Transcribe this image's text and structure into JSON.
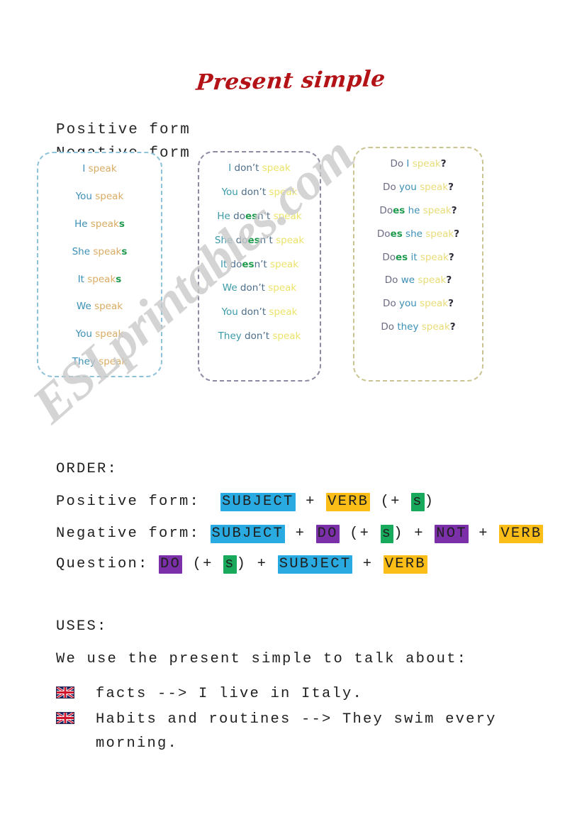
{
  "title": "Present simple",
  "headings": {
    "positive": "Positive form",
    "negative": "Negative form"
  },
  "watermark": "ESLprintables.com",
  "colors": {
    "title": "#b31217",
    "highlight_subject": "#29abe2",
    "highlight_verb": "#fbbe18",
    "highlight_s": "#18a95c",
    "highlight_do_not": "#7b2fa8",
    "box_positive_border": "#8ec2d8",
    "box_negative_border": "#8d89a3",
    "box_question_border": "#c9c490",
    "pronoun_blue": "#3b8fb5",
    "speak_tan": "#d9ab63",
    "speak_yellow": "#ece36a",
    "s_green": "#1f9b4e",
    "do_purple": "#7d7a9c"
  },
  "positive_box": {
    "lines": [
      {
        "pron": "I",
        "verb": " speak",
        "s": ""
      },
      {
        "pron": "You",
        "verb": " speak",
        "s": ""
      },
      {
        "pron": "He",
        "verb": " speak",
        "s": "s"
      },
      {
        "pron": "She",
        "verb": " speak",
        "s": "s"
      },
      {
        "pron": "It",
        "verb": " speak",
        "s": "s"
      },
      {
        "pron": "We",
        "verb": " speak",
        "s": ""
      },
      {
        "pron": "You",
        "verb": " speak",
        "s": ""
      },
      {
        "pron": "They",
        "verb": " speak",
        "s": ""
      }
    ]
  },
  "negative_box": {
    "lines": [
      {
        "pron": "I",
        "aux_pre": " don",
        "aux_es": "",
        "aux_post": "’t",
        "verb": " speak"
      },
      {
        "pron": "You",
        "aux_pre": " don",
        "aux_es": "",
        "aux_post": "’t",
        "verb": " speak"
      },
      {
        "pron": "He",
        "aux_pre": " do",
        "aux_es": "es",
        "aux_post": "n’t",
        "verb": " speak"
      },
      {
        "pron": "She",
        "aux_pre": " do",
        "aux_es": "es",
        "aux_post": "n’t",
        "verb": " speak"
      },
      {
        "pron": "It",
        "aux_pre": " do",
        "aux_es": "es",
        "aux_post": "n’t",
        "verb": " speak"
      },
      {
        "pron": "We",
        "aux_pre": " don",
        "aux_es": "",
        "aux_post": "’t",
        "verb": " speak"
      },
      {
        "pron": "You",
        "aux_pre": " don",
        "aux_es": "",
        "aux_post": "’t",
        "verb": " speak"
      },
      {
        "pron": "They",
        "aux_pre": " don",
        "aux_es": "",
        "aux_post": "’t",
        "verb": " speak"
      }
    ]
  },
  "question_box": {
    "lines": [
      {
        "do": "Do",
        "es": "",
        "pron": " I ",
        "verb": "speak",
        "mark": "?"
      },
      {
        "do": "Do",
        "es": "",
        "pron": " you ",
        "verb": "speak",
        "mark": "?"
      },
      {
        "do": "Do",
        "es": "es",
        "pron": " he ",
        "verb": "speak",
        "mark": "?"
      },
      {
        "do": "Do",
        "es": "es",
        "pron": " she ",
        "verb": "speak",
        "mark": "?"
      },
      {
        "do": "Do",
        "es": "es",
        "pron": " it ",
        "verb": "speak",
        "mark": "?"
      },
      {
        "do": "Do",
        "es": "",
        "pron": " we ",
        "verb": "speak",
        "mark": "?"
      },
      {
        "do": "Do",
        "es": "",
        "pron": " you ",
        "verb": "speak",
        "mark": "?"
      },
      {
        "do": "Do",
        "es": "",
        "pron": " they ",
        "verb": "speak",
        "mark": "?"
      }
    ]
  },
  "order": {
    "heading": "ORDER:",
    "positive": {
      "label": "Positive form:",
      "subject": "SUBJECT",
      "plus1": "+",
      "verb": "VERB",
      "open": "(+",
      "s": "s",
      "close": ")"
    },
    "negative": {
      "label": "Negative form:",
      "subject": "SUBJECT",
      "plus1": "+",
      "do": "DO",
      "open": "(+",
      "s": "s",
      "close": ")",
      "plus2": "+",
      "not": "NOT",
      "plus3": "+",
      "verb": "VERB"
    },
    "question": {
      "label": "Question:",
      "do": "DO",
      "open": "(+",
      "s": "s",
      "close": ")",
      "plus1": "+",
      "subject": "SUBJECT",
      "plus2": "+",
      "verb": "VERB"
    }
  },
  "uses": {
    "heading": "USES:",
    "intro": "We use the present simple to talk about:",
    "items": [
      {
        "icon": "uk-flag-icon",
        "text": "facts --> I live in Italy."
      },
      {
        "icon": "uk-flag-icon",
        "text": "Habits and routines --> They swim every morning."
      }
    ]
  }
}
